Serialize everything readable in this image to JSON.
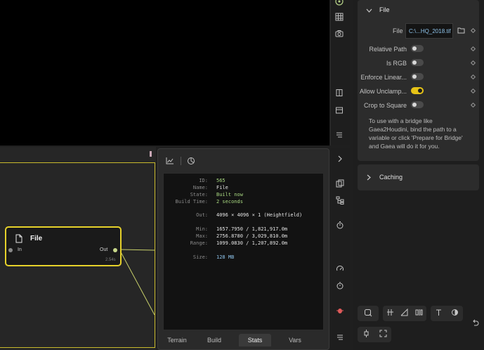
{
  "viewport_toolbar": {
    "icons": [
      "target-icon",
      "grid-icon",
      "camera-icon",
      "book-icon",
      "layout-icon",
      "menu-icon"
    ]
  },
  "node": {
    "title": "File",
    "in_label": "In",
    "out_label": "Out",
    "time": "2.54s"
  },
  "stats": {
    "rows": [
      {
        "label": "ID:",
        "value": "565"
      },
      {
        "label": "Name:",
        "value": "File"
      },
      {
        "label": "State:",
        "value": "Built now"
      },
      {
        "label": "Build Time:",
        "value": "2 seconds"
      },
      {
        "label": "Out:",
        "value": "4096 × 4096 × 1 (Heightfield)"
      },
      {
        "label": "Min:",
        "value": "1657.7950 / 1,821,917.0m"
      },
      {
        "label": "Max:",
        "value": "2756.8780 / 3,029,810.0m"
      },
      {
        "label": "Range:",
        "value": "1099.0830 / 1,207,892.0m"
      },
      {
        "label": "Size:",
        "value": "128 MB"
      }
    ]
  },
  "tabs": [
    "Terrain",
    "Build",
    "Stats",
    "Vars"
  ],
  "active_tab": "Stats",
  "properties": {
    "file_section_title": "File",
    "file_label": "File",
    "file_value": "C:\\...HQ_2018.tif",
    "toggles": [
      {
        "label": "Relative Path",
        "on": false
      },
      {
        "label": "Is RGB",
        "on": false
      },
      {
        "label": "Enforce Linear...",
        "on": false
      },
      {
        "label": "Allow Unclamp...",
        "on": true
      },
      {
        "label": "Crop to Square",
        "on": false
      }
    ],
    "help_text": "To use with a bridge like Gaea2Houdini, bind the path to a variable or click 'Prepare for Bridge' and Gaea will do it for you.",
    "caching_title": "Caching"
  },
  "colors": {
    "accent": "#e6d12a",
    "toggle_on": "#e6c317",
    "file_value": "#8ec3ea"
  }
}
